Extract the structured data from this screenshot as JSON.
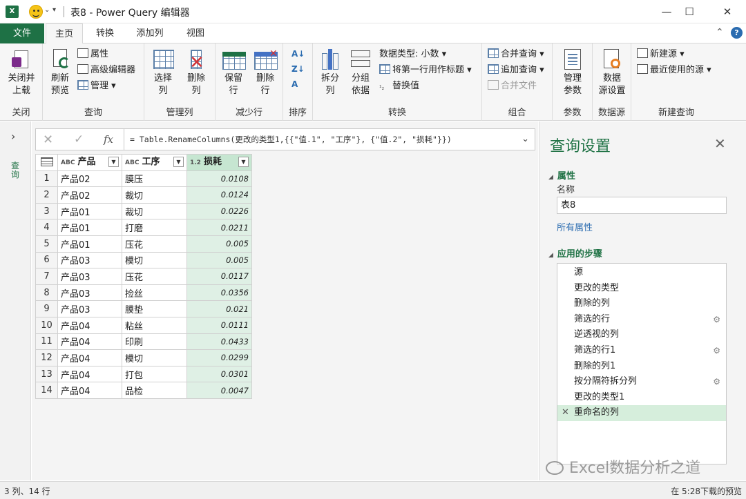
{
  "titlebar": {
    "logo": "X",
    "title": "表8 - Power Query 编辑器",
    "minimize": "—",
    "maximize": "☐",
    "close": "✕"
  },
  "ribbon_tabs": [
    "文件",
    "主页",
    "转换",
    "添加列",
    "视图"
  ],
  "ribbon": {
    "close_group": {
      "btn": "关闭并\n上载",
      "btn_arrow": "▾",
      "label": "关闭"
    },
    "query_group": {
      "refresh": "刷新\n预览",
      "props": "属性",
      "advanced": "高级编辑器",
      "manage": "管理",
      "label": "查询"
    },
    "cols_group": {
      "select": "选择\n列",
      "remove": "删除\n列",
      "label": "管理列"
    },
    "rows_group": {
      "keep": "保留\n行",
      "remove": "删除\n行",
      "label": "减少行"
    },
    "sort_group": {
      "label": "排序"
    },
    "transform_group": {
      "split": "拆分\n列",
      "group": "分组\n依据",
      "datatype": "数据类型: 小数",
      "firstrow": "将第一行用作标题",
      "replace": "替换值",
      "label": "转换"
    },
    "combine_group": {
      "merge": "合并查询",
      "append": "追加查询",
      "combine_files": "合并文件",
      "label": "组合"
    },
    "params_group": {
      "manage": "管理\n参数",
      "label": "参数"
    },
    "ds_group": {
      "settings": "数据\n源设置",
      "label": "数据源"
    },
    "newq_group": {
      "newsource": "新建源",
      "recent": "最近使用的源",
      "label": "新建查询"
    }
  },
  "leftbar": {
    "label": "查询"
  },
  "formula_bar": {
    "cancel": "✕",
    "confirm": "✓",
    "fx": "fx",
    "formula": "= Table.RenameColumns(更改的类型1,{{\"值.1\", \"工序\"}, {\"值.2\", \"损耗\"}})"
  },
  "table": {
    "columns": [
      {
        "type": "ABC",
        "name": "产品"
      },
      {
        "type": "ABC",
        "name": "工序"
      },
      {
        "type": "1.2",
        "name": "损耗"
      }
    ],
    "rows": [
      [
        "1",
        "产品02",
        "膜压",
        "0.0108"
      ],
      [
        "2",
        "产品02",
        "裁切",
        "0.0124"
      ],
      [
        "3",
        "产品01",
        "裁切",
        "0.0226"
      ],
      [
        "4",
        "产品01",
        "打磨",
        "0.0211"
      ],
      [
        "5",
        "产品01",
        "压花",
        "0.005"
      ],
      [
        "6",
        "产品03",
        "模切",
        "0.005"
      ],
      [
        "7",
        "产品03",
        "压花",
        "0.0117"
      ],
      [
        "8",
        "产品03",
        "捡丝",
        "0.0356"
      ],
      [
        "9",
        "产品03",
        "膜垫",
        "0.021"
      ],
      [
        "10",
        "产品04",
        "粘丝",
        "0.0111"
      ],
      [
        "11",
        "产品04",
        "印刷",
        "0.0433"
      ],
      [
        "12",
        "产品04",
        "模切",
        "0.0299"
      ],
      [
        "13",
        "产品04",
        "打包",
        "0.0301"
      ],
      [
        "14",
        "产品04",
        "品检",
        "0.0047"
      ]
    ]
  },
  "query_settings": {
    "title": "查询设置",
    "props_header": "属性",
    "name_label": "名称",
    "name_value": "表8",
    "all_props": "所有属性",
    "steps_header": "应用的步骤",
    "steps": [
      {
        "label": "源",
        "gear": false
      },
      {
        "label": "更改的类型",
        "gear": false
      },
      {
        "label": "删除的列",
        "gear": false
      },
      {
        "label": "筛选的行",
        "gear": true
      },
      {
        "label": "逆透视的列",
        "gear": false
      },
      {
        "label": "筛选的行1",
        "gear": true
      },
      {
        "label": "删除的列1",
        "gear": false
      },
      {
        "label": "按分隔符拆分列",
        "gear": true
      },
      {
        "label": "更改的类型1",
        "gear": false
      },
      {
        "label": "重命名的列",
        "gear": false,
        "selected": true
      }
    ]
  },
  "watermark": "Excel数据分析之道",
  "status": {
    "left": "3 列、14 行",
    "right": "在 5:28下载的预览"
  }
}
